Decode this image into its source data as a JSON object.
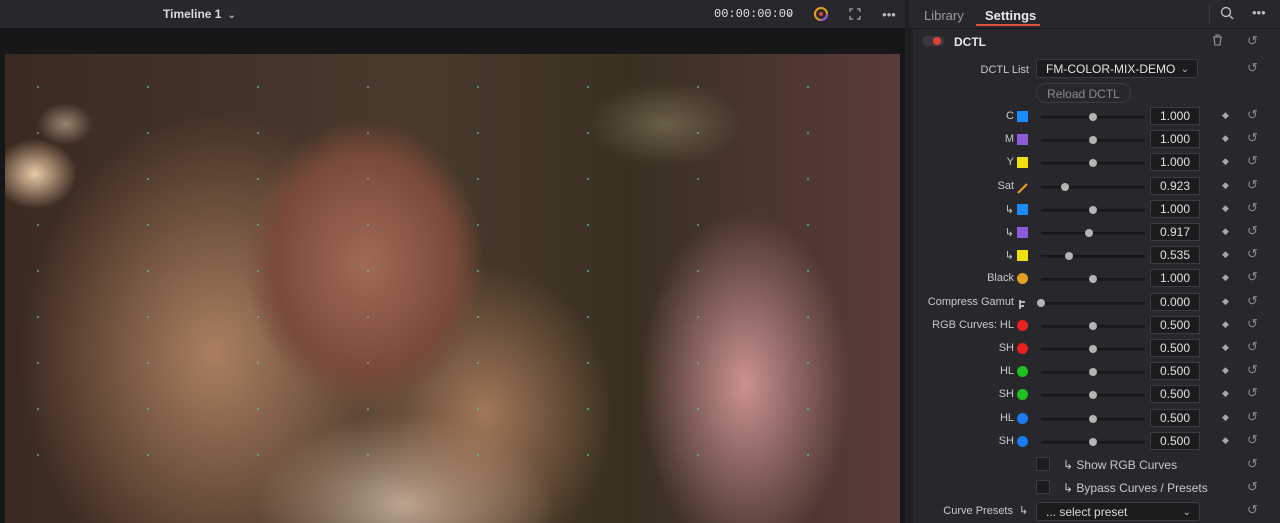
{
  "viewer": {
    "timeline_name": "Timeline 1",
    "timecode": "00:00:00:00"
  },
  "panel": {
    "tabs": [
      "Library",
      "Settings"
    ],
    "active_tab": "Settings",
    "section_title": "DCTL",
    "dctl_list_label": "DCTL List",
    "dctl_list_value": "FM-COLOR-MIX-DEMO",
    "reload_label": "Reload DCTL",
    "params": [
      {
        "label": "C",
        "icon": "cyan-square-icon",
        "color": "#1a8cff",
        "value": "1.000",
        "level": 0.5
      },
      {
        "label": "M",
        "icon": "magenta-square-icon",
        "color": "#8a5cd8",
        "value": "1.000",
        "level": 0.5
      },
      {
        "label": "Y",
        "icon": "yellow-square-icon",
        "color": "#f0e010",
        "value": "1.000",
        "level": 0.5
      },
      {
        "label": "Sat",
        "icon": "saturation-icon",
        "color": "#f0a020",
        "value": "0.923",
        "level": 0.23
      },
      {
        "label": "↳",
        "icon": "cyan-square-icon",
        "color": "#1a8cff",
        "value": "1.000",
        "level": 0.5
      },
      {
        "label": "↳",
        "icon": "magenta-square-icon",
        "color": "#8a5cd8",
        "value": "0.917",
        "level": 0.46
      },
      {
        "label": "↳",
        "icon": "yellow-square-icon",
        "color": "#f0e010",
        "value": "0.535",
        "level": 0.27
      },
      {
        "label": "Black",
        "icon": "black-half-circle-icon",
        "color": "#e0a020",
        "value": "1.000",
        "level": 0.5
      },
      {
        "label": "Compress Gamut",
        "icon": "compress-gamut-icon",
        "color": "#d8d8d8",
        "value": "0.000",
        "level": 0.0
      },
      {
        "label": "RGB Curves: HL",
        "icon": "red-circle-icon",
        "color": "#e82020",
        "value": "0.500",
        "level": 0.5
      },
      {
        "label": "SH",
        "icon": "red-circle-icon",
        "color": "#e82020",
        "value": "0.500",
        "level": 0.5
      },
      {
        "label": "HL",
        "icon": "green-circle-icon",
        "color": "#20c020",
        "value": "0.500",
        "level": 0.5
      },
      {
        "label": "SH",
        "icon": "green-circle-icon",
        "color": "#20c020",
        "value": "0.500",
        "level": 0.5
      },
      {
        "label": "HL",
        "icon": "blue-circle-icon",
        "color": "#1a7cf0",
        "value": "0.500",
        "level": 0.5
      },
      {
        "label": "SH",
        "icon": "blue-circle-icon",
        "color": "#1a7cf0",
        "value": "0.500",
        "level": 0.5
      }
    ],
    "show_rgb_curves_label": "↳ Show RGB Curves",
    "bypass_label": "↳ Bypass Curves / Presets",
    "curve_presets_label": "Curve Presets",
    "curve_presets_arrow": "↳",
    "curve_presets_value": "... select preset"
  }
}
